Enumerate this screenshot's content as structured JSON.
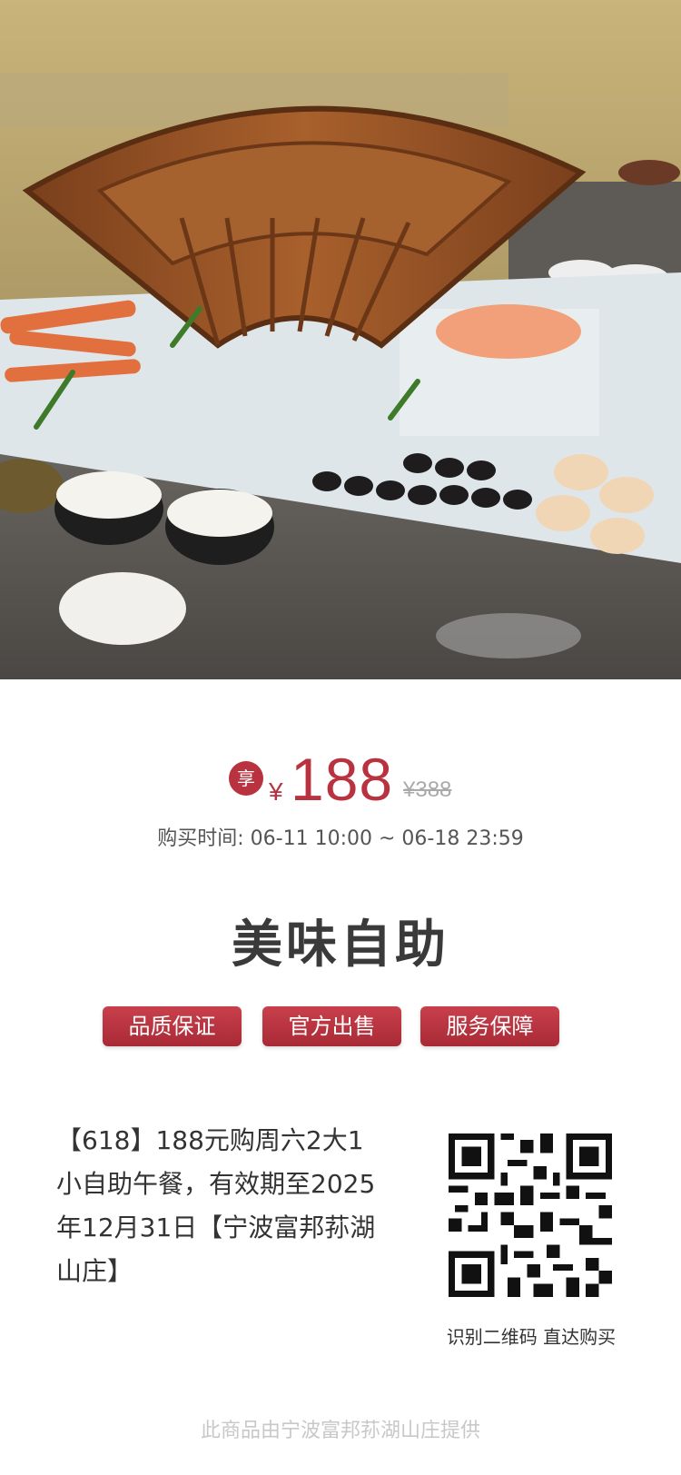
{
  "hero": {
    "description_icon": "buffet-photo"
  },
  "price": {
    "badge": "享",
    "currency": "¥",
    "current": "188",
    "original": "¥388"
  },
  "purchase_time": "购买时间:  06-11 10:00 ~ 06-18 23:59",
  "title": "美味自助",
  "tags": [
    "品质保证",
    "官方出售",
    "服务保障"
  ],
  "description": "【618】188元购周六2大1小自助午餐，有效期至2025年12月31日【宁波富邦荪湖山庄】",
  "qr": {
    "caption": "识别二维码 直达购买"
  },
  "footer": "此商品由宁波富邦荪湖山庄提供",
  "colors": {
    "accent": "#b8323f",
    "muted": "#aaaaaa"
  }
}
